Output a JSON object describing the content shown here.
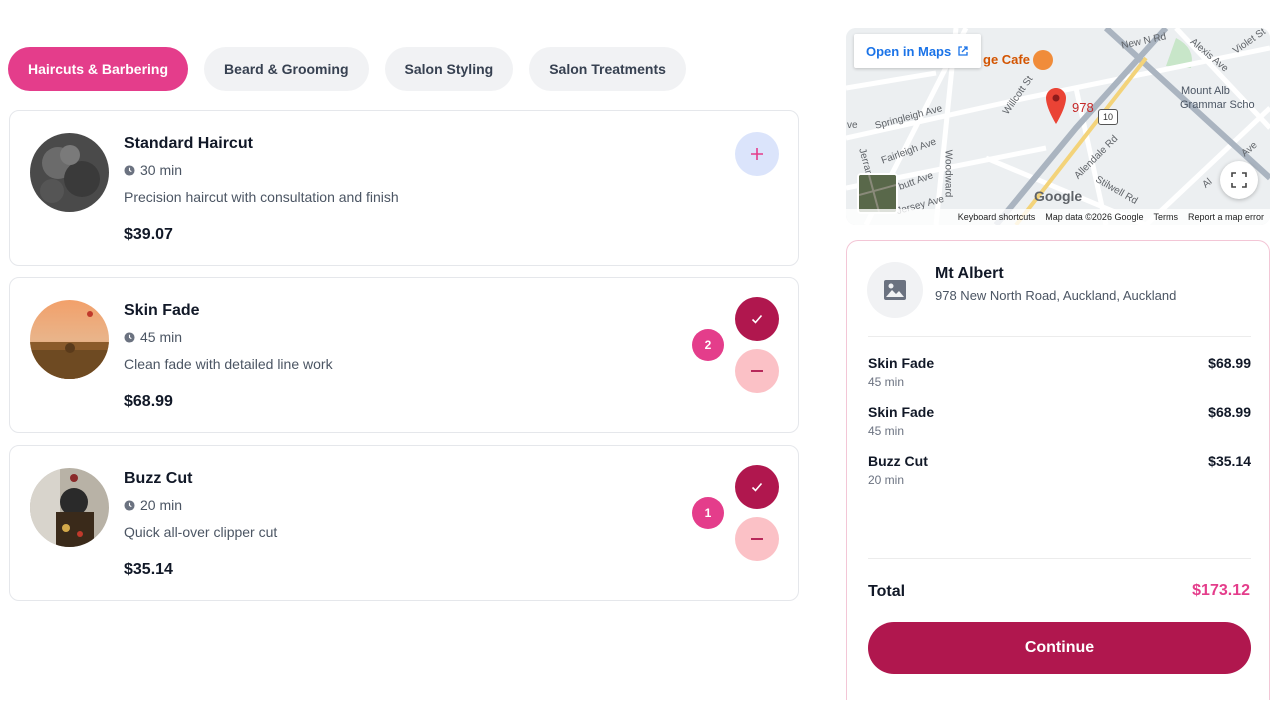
{
  "categories": {
    "tabs": [
      {
        "label": "Haircuts & Barbering",
        "active": true
      },
      {
        "label": "Beard & Grooming",
        "active": false
      },
      {
        "label": "Salon Styling",
        "active": false
      },
      {
        "label": "Salon Treatments",
        "active": false
      }
    ]
  },
  "services": [
    {
      "name": "Standard Haircut",
      "duration": "30 min",
      "description": "Precision haircut with consultation and finish",
      "price": "$39.07",
      "selected": false
    },
    {
      "name": "Skin Fade",
      "duration": "45 min",
      "description": "Clean fade with detailed line work",
      "price": "$68.99",
      "selected": true,
      "quantity": "2"
    },
    {
      "name": "Buzz Cut",
      "duration": "20 min",
      "description": "Quick all-over clipper cut",
      "price": "$35.14",
      "selected": true,
      "quantity": "1"
    }
  ],
  "map": {
    "open_in_maps": "Open in Maps",
    "cafe_label": "ge Cafe",
    "pin_label": "978",
    "route_number": "10",
    "labels": {
      "mount_albert_1": "Mount Alb",
      "mount_albert_2": "Grammar Scho",
      "new_north_rd": "New N Rd",
      "alexis_ave": "Alexis Ave",
      "violet_st": "Violet St",
      "springleigh_ave": "Springleigh Ave",
      "fairleigh_ave": "Fairleigh Ave",
      "willcott_st": "Willcott St",
      "allendale_rd": "Allendale Rd",
      "stilwell_rd": "Stilwell Rd",
      "woodward": "Woodward",
      "jerram": "Jerram",
      "butt_ave": "butt Ave",
      "jersey_ave": "Jersey Ave",
      "ve": "ve",
      "ave_right": "Ave",
      "al_partial": "Al"
    },
    "google": "Google",
    "attribution": {
      "shortcuts": "Keyboard shortcuts",
      "data": "Map data ©2026 Google",
      "terms": "Terms",
      "report": "Report a map error"
    }
  },
  "summary": {
    "location_name": "Mt Albert",
    "location_address": "978 New North Road, Auckland, Auckland",
    "items": [
      {
        "name": "Skin Fade",
        "duration": "45 min",
        "price": "$68.99"
      },
      {
        "name": "Skin Fade",
        "duration": "45 min",
        "price": "$68.99"
      },
      {
        "name": "Buzz Cut",
        "duration": "20 min",
        "price": "$35.14"
      }
    ],
    "total_label": "Total",
    "total_value": "$173.12",
    "continue_label": "Continue"
  },
  "colors": {
    "accent_pink": "#e43d8b",
    "primary_maroon": "#b0174e",
    "minus_bg": "#fbc1c6",
    "add_bg": "#dbe4fb"
  }
}
